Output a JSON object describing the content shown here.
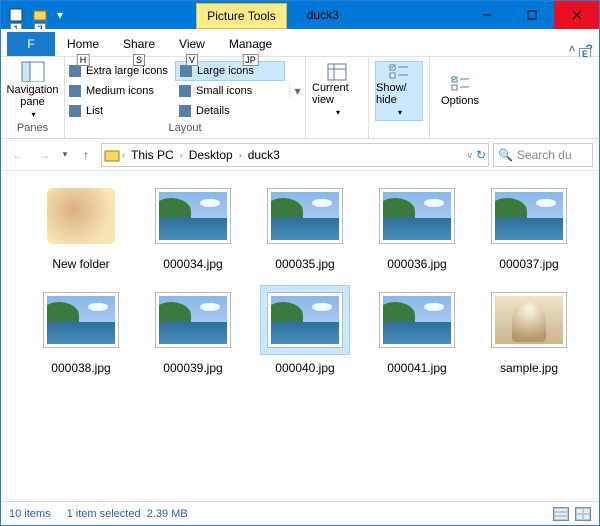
{
  "titlebar": {
    "qat_keys": [
      "1",
      "2"
    ],
    "picture_tools": "Picture Tools",
    "title": "duck3"
  },
  "tabs": {
    "file": "F",
    "file_label": "File",
    "home": "Home",
    "home_key": "H",
    "share": "Share",
    "share_key": "S",
    "view": "View",
    "view_key": "V",
    "manage": "Manage",
    "manage_key": "JP",
    "expand_key": "E"
  },
  "ribbon": {
    "panes": {
      "label": "Panes",
      "navpane": "Navigation pane"
    },
    "layout": {
      "label": "Layout",
      "items": [
        {
          "label": "Extra large icons"
        },
        {
          "label": "Large icons",
          "selected": true
        },
        {
          "label": "Medium icons"
        },
        {
          "label": "Small icons"
        },
        {
          "label": "List"
        },
        {
          "label": "Details"
        }
      ]
    },
    "current_view": "Current view",
    "show_hide": "Show/ hide",
    "options": "Options"
  },
  "address": {
    "crumbs": [
      "This PC",
      "Desktop",
      "duck3"
    ],
    "search_placeholder": "Search du"
  },
  "items": [
    {
      "label": "New folder",
      "kind": "folder"
    },
    {
      "label": "000034.jpg",
      "kind": "pic"
    },
    {
      "label": "000035.jpg",
      "kind": "pic"
    },
    {
      "label": "000036.jpg",
      "kind": "pic"
    },
    {
      "label": "000037.jpg",
      "kind": "pic"
    },
    {
      "label": "000038.jpg",
      "kind": "pic"
    },
    {
      "label": "000039.jpg",
      "kind": "pic"
    },
    {
      "label": "000040.jpg",
      "kind": "pic",
      "selected": true
    },
    {
      "label": "000041.jpg",
      "kind": "pic"
    },
    {
      "label": "sample.jpg",
      "kind": "sample"
    }
  ],
  "status": {
    "count": "10 items",
    "selection": "1 item selected",
    "size": "2.39 MB"
  }
}
